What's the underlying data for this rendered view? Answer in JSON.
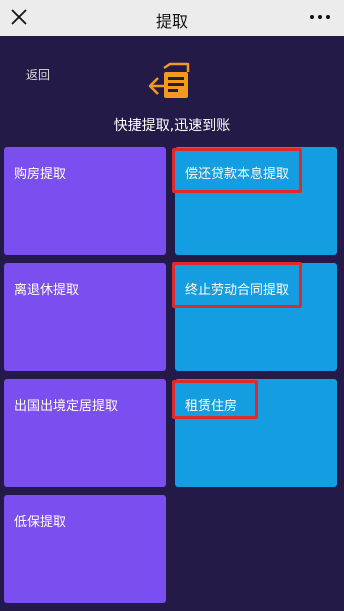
{
  "topbar": {
    "title": "提取",
    "close_icon": "close-icon",
    "more_icon": "more-icon"
  },
  "header": {
    "back_label": "返回",
    "hero_icon": "document-return-icon",
    "subtitle": "快捷提取,迅速到账"
  },
  "tiles": [
    {
      "label": "购房提取",
      "color": "#7b4ef0"
    },
    {
      "label": "偿还贷款本息提取",
      "color": "#159de1",
      "highlighted": true
    },
    {
      "label": "离退休提取",
      "color": "#7b4ef0"
    },
    {
      "label": "终止劳动合同提取",
      "color": "#159de1",
      "highlighted": true
    },
    {
      "label": "出国出境定居提取",
      "color": "#7b4ef0"
    },
    {
      "label": "租赁住房",
      "color": "#159de1",
      "highlighted": true
    },
    {
      "label": "低保提取",
      "color": "#7b4ef0"
    }
  ],
  "colors": {
    "background": "#241a48",
    "topbar": "#ececec",
    "purple_tile": "#7b4ef0",
    "blue_tile": "#159de1",
    "highlight": "#e02a2a"
  }
}
